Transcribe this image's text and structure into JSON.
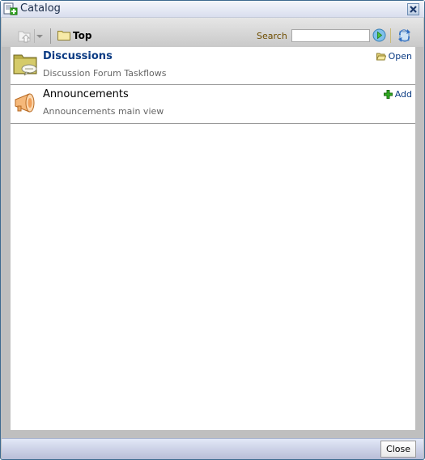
{
  "window": {
    "title": "Catalog",
    "title_icon": "catalog-add-icon",
    "close_icon": "close-icon"
  },
  "toolbar": {
    "up_icon": "folder-up-icon",
    "dropdown_icon": "chevron-down-icon",
    "breadcrumb": {
      "icon": "folder-icon",
      "label": "Top"
    },
    "search": {
      "label": "Search",
      "value": "",
      "placeholder": ""
    },
    "go_icon": "go-arrow-icon",
    "refresh_icon": "refresh-icon"
  },
  "items": [
    {
      "title": "Discussions",
      "description": "Discussion Forum Taskflows",
      "icon": "discussion-folder-icon",
      "action": {
        "label": "Open",
        "icon": "open-folder-icon"
      }
    },
    {
      "title": "Announcements",
      "description": "Announcements main view",
      "icon": "megaphone-icon",
      "action": {
        "label": "Add",
        "icon": "add-plus-icon"
      }
    }
  ],
  "footer": {
    "close_label": "Close"
  },
  "colors": {
    "link": "#0b3b83",
    "search_label": "#6e4d00",
    "add_green": "#2fae1f"
  }
}
